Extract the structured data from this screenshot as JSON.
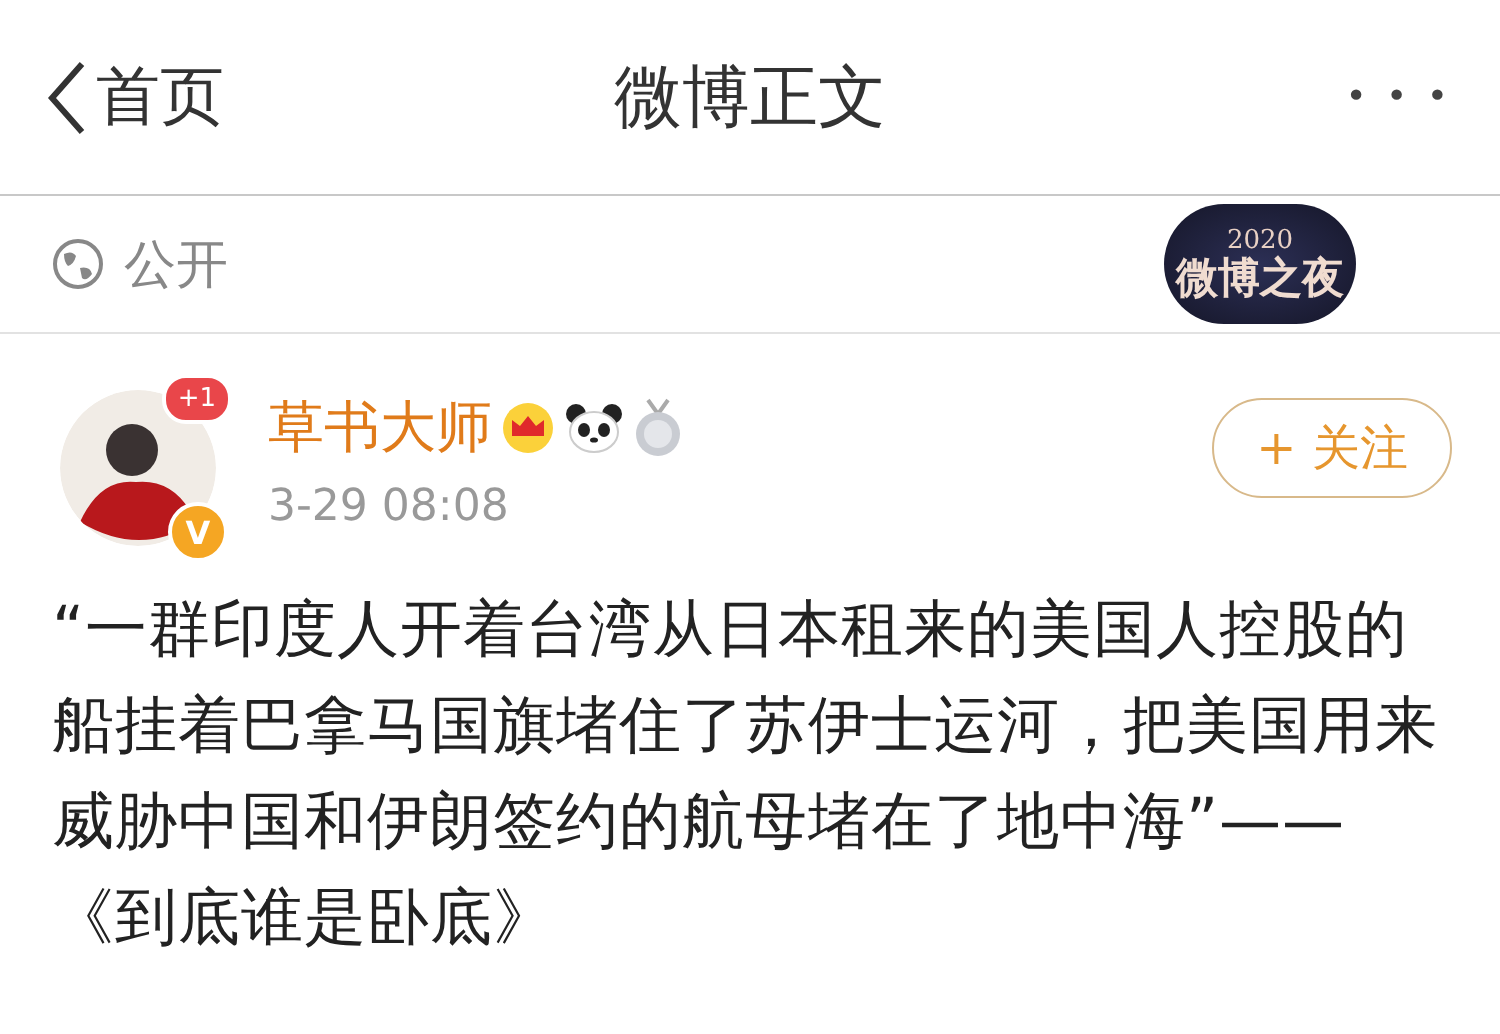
{
  "nav": {
    "back": "首页",
    "title": "微博正文",
    "more": "• • •"
  },
  "visibility": {
    "label": "公开",
    "event_logo": {
      "year": "2020",
      "name": "微博之夜"
    }
  },
  "post": {
    "author": "草书大师",
    "avatar_badge": "+1",
    "verified": "V",
    "time": "3-29 08:08",
    "follow": "+ 关注",
    "text": "“一群印度人开着台湾从日本租来的美国人控股的船挂着巴拿马国旗堵住了苏伊士运河，把美国用来威胁中国和伊朗签约的航母堵在了地中海”——《到底谁是卧底》"
  }
}
